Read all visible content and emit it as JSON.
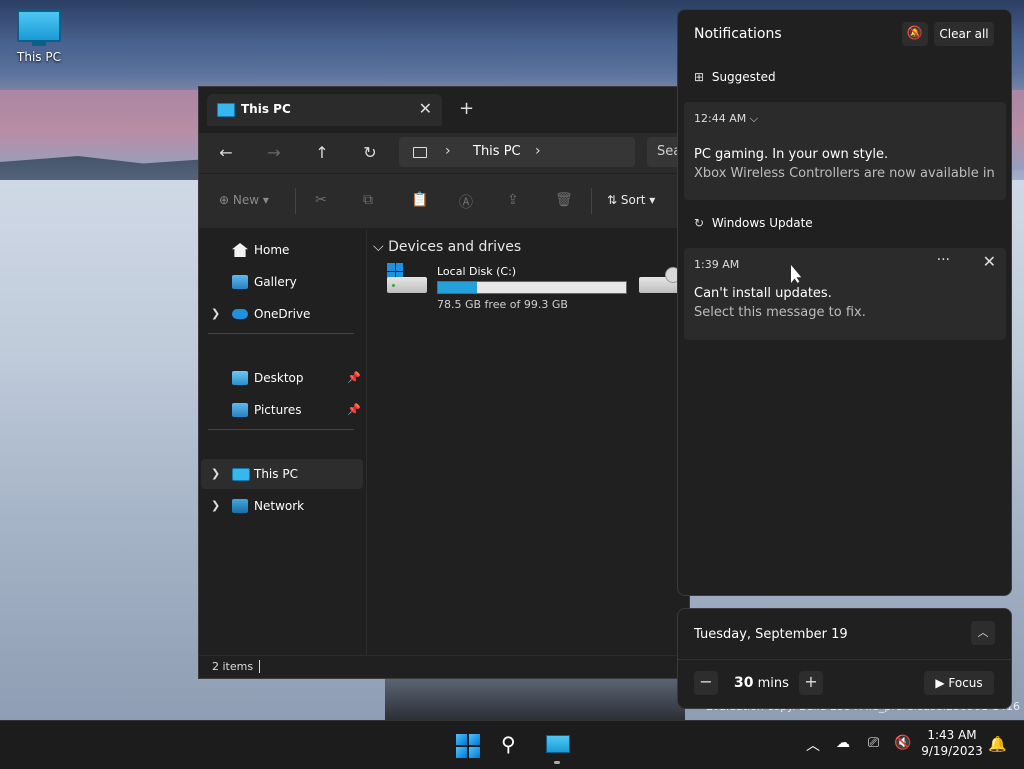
{
  "desktop": {
    "icon_label": "This PC",
    "watermark": "Evaluation copy. Build 25947.rs_prerelease.230901-1416"
  },
  "explorer": {
    "tab_title": "This PC",
    "breadcrumb": "This PC",
    "search_placeholder": "Sea",
    "toolbar": {
      "new_label": "New",
      "sort_label": "Sort"
    },
    "sidebar": {
      "home": "Home",
      "gallery": "Gallery",
      "onedrive": "OneDrive",
      "desktop": "Desktop",
      "pictures": "Pictures",
      "this_pc": "This PC",
      "network": "Network"
    },
    "group_header": "Devices and drives",
    "drive": {
      "name": "Local Disk (C:)",
      "free_text": "78.5 GB free of 99.3 GB",
      "used_fraction": 0.21
    },
    "status": "2 items"
  },
  "notifications": {
    "title": "Notifications",
    "clear_all": "Clear all",
    "group1": "Suggested",
    "card1": {
      "time": "12:44 AM",
      "title": "PC gaming. In your own style.",
      "body": "Xbox Wireless Controllers are now available in a"
    },
    "group2": "Windows Update",
    "card2": {
      "time": "1:39 AM",
      "title": "Can't install updates.",
      "body": "Select this message to fix."
    }
  },
  "calendar": {
    "date": "Tuesday, September 19",
    "focus_minutes": "30",
    "focus_unit": "mins",
    "focus_button": "Focus"
  },
  "taskbar": {
    "time": "1:43 AM",
    "date": "9/19/2023"
  }
}
